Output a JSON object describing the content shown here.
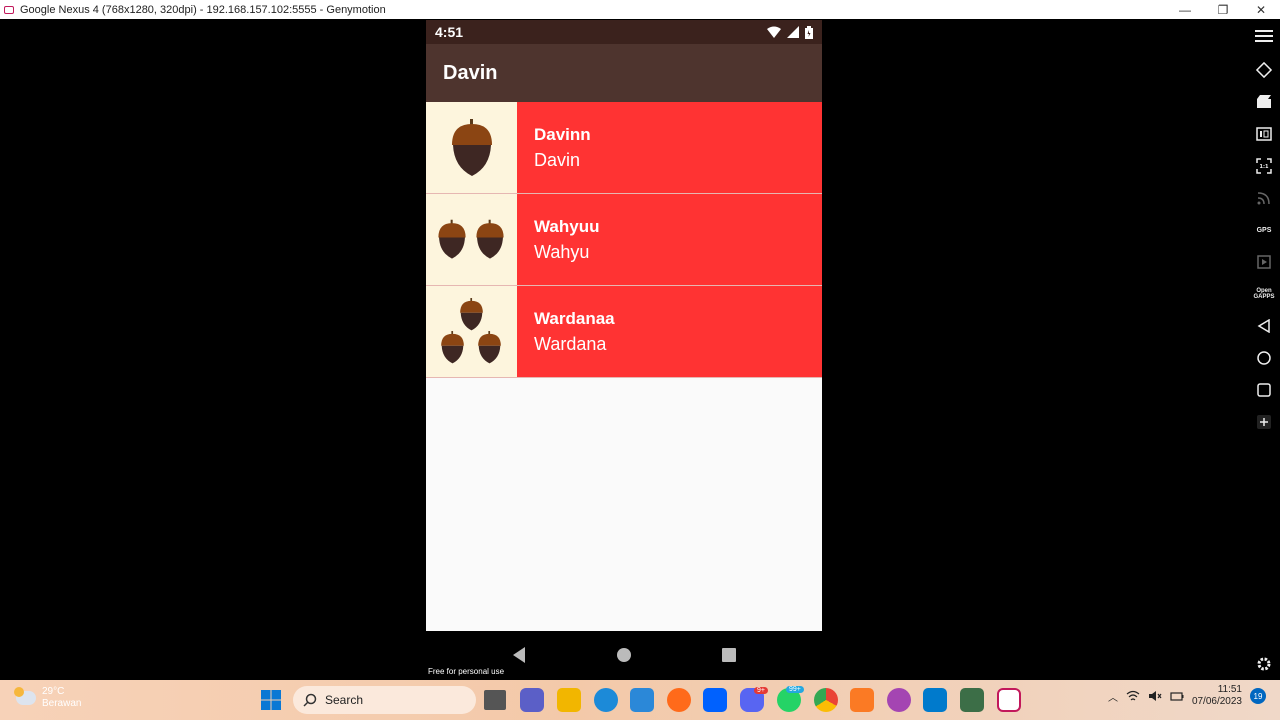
{
  "window": {
    "title": "Google Nexus 4 (768x1280, 320dpi) - 192.168.157.102:5555 - Genymotion",
    "minimize": "—",
    "maximize": "❐",
    "close": "✕"
  },
  "phone": {
    "status_time": "4:51",
    "app_title": "Davin",
    "items": [
      {
        "name": "Davinn",
        "subtitle": "Davin",
        "acorns": 1
      },
      {
        "name": "Wahyuu",
        "subtitle": "Wahyu",
        "acorns": 2
      },
      {
        "name": "Wardanaa",
        "subtitle": "Wardana",
        "acorns": 3
      }
    ],
    "colors": {
      "appbar": "#4e342e",
      "statusbar": "#3b221d",
      "item_bg": "#ff3333",
      "thumb_bg": "#fdf5dd"
    }
  },
  "watermark": "Free for personal use",
  "sidebar": {
    "gps_label": "GPS",
    "open_gapps_label": "Open GAPPS",
    "pixel_label": "1:1"
  },
  "taskbar": {
    "weather_temp": "29°C",
    "weather_desc": "Berawan",
    "search_label": "Search",
    "discord_badge": "9+",
    "whatsapp_badge": "99+",
    "clock_time": "11:51",
    "clock_date": "07/06/2023",
    "notification_count": "19"
  }
}
